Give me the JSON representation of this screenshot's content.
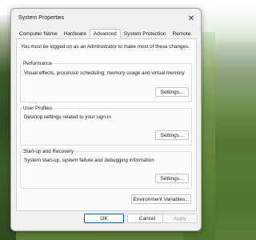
{
  "window": {
    "title": "System Properties",
    "close_glyph": "✕"
  },
  "tabs": [
    {
      "label": "Computer Name",
      "active": false
    },
    {
      "label": "Hardware",
      "active": false
    },
    {
      "label": "Advanced",
      "active": true
    },
    {
      "label": "System Protection",
      "active": false
    },
    {
      "label": "Remote",
      "active": false
    }
  ],
  "panel": {
    "notice": "You must be logged on as an Administrator to make most of these changes.",
    "performance": {
      "title": "Performance",
      "description": "Visual effects, processor scheduling, memory usage and virtual memory",
      "button": "Settings..."
    },
    "user_profiles": {
      "title": "User Profiles",
      "description": "Desktop settings related to your sign-in",
      "button": "Settings..."
    },
    "startup_recovery": {
      "title": "Start-up and Recovery",
      "description": "System start-up, system failure and debugging information",
      "button": "Settings..."
    },
    "env_button": "Environment Variables..."
  },
  "footer": {
    "ok": "OK",
    "cancel": "Cancel",
    "apply": "Apply"
  }
}
